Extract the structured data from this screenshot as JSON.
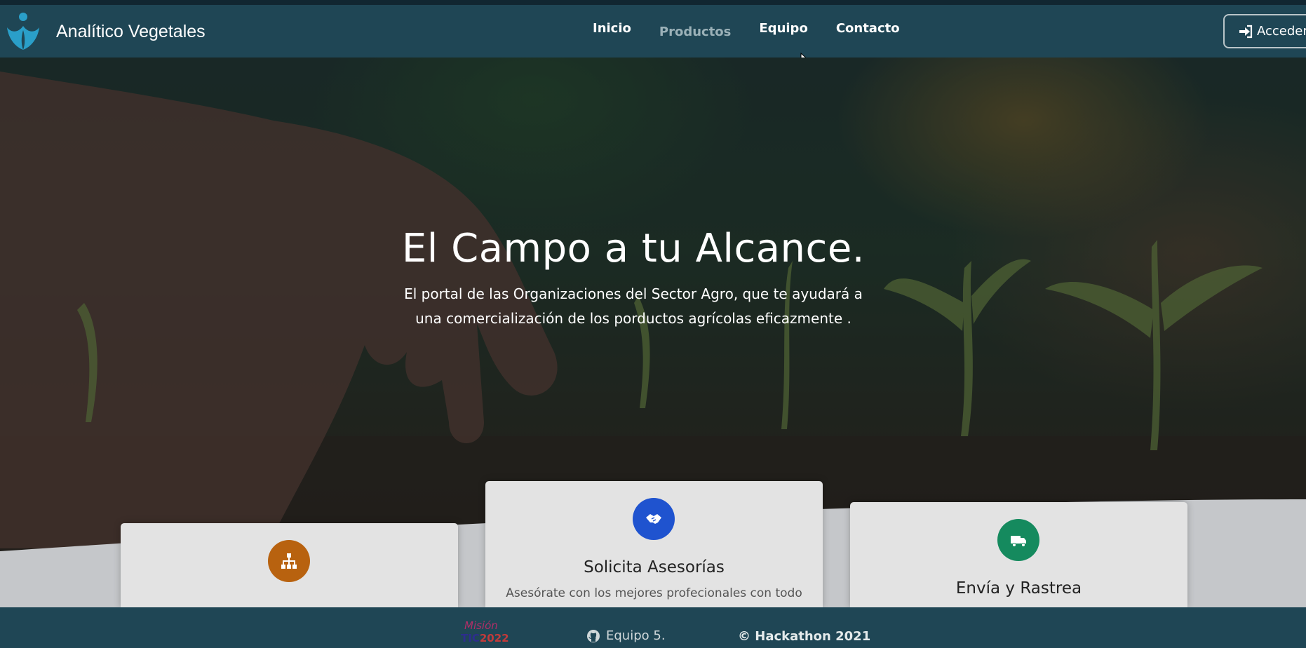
{
  "navbar": {
    "brand_name": "Analítico Vegetales",
    "links": [
      "Inicio",
      "Productos",
      "Equipo",
      "Contacto"
    ],
    "login_label": "Acceder"
  },
  "hero": {
    "title": "El Campo a tu Alcance.",
    "subtitle": "El portal de las Organizaciones del Sector Agro, que te ayudará a una comercialización de los porductos agrícolas eficazmente ."
  },
  "cards": [
    {
      "title": "",
      "icon": "sitemap-icon",
      "color": "#b8620f"
    },
    {
      "title": "Solicita Asesorías",
      "text": "Asesórate con los mejores profecionales con todo",
      "icon": "handshake-icon",
      "color": "#1f53cf"
    },
    {
      "title": "Envía y Rastrea",
      "icon": "truck-icon",
      "color": "#158a5e"
    }
  ],
  "footer": {
    "logo_line1": "Misión",
    "logo_line2": "TIC",
    "logo_year": "2022",
    "team": "Equipo 5.",
    "copyright": "© Hackathon 2021"
  },
  "colors": {
    "navbar": "#1f4655",
    "accent_orange": "#b8620f",
    "accent_blue": "#1f53cf",
    "accent_green": "#158a5e"
  }
}
